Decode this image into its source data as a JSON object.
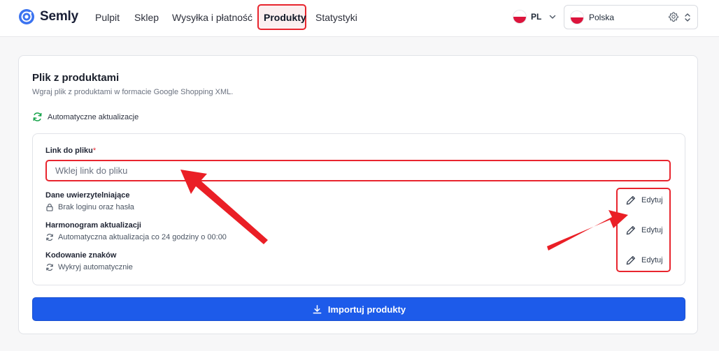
{
  "app": {
    "name": "Semly"
  },
  "nav": {
    "items": [
      {
        "label": "Pulpit"
      },
      {
        "label": "Sklep"
      },
      {
        "label": "Wysyłka i płatność"
      },
      {
        "label": "Produkty"
      },
      {
        "label": "Statystyki"
      }
    ],
    "active": "Produkty"
  },
  "header": {
    "language": "PL",
    "country": "Polska"
  },
  "product_file": {
    "title": "Plik z produktami",
    "subtitle": "Wgraj plik z produktami w formacie Google Shopping XML.",
    "auto_updates_label": "Automatyczne aktualizacje",
    "link_label": "Link do pliku",
    "required_mark": "*",
    "link_placeholder": "Wklej link do pliku",
    "link_value": "",
    "settings": [
      {
        "title": "Dane uwierzytelniające",
        "value": "Brak loginu oraz hasła",
        "icon": "lock-icon",
        "action": "Edytuj"
      },
      {
        "title": "Harmonogram aktualizacji",
        "value": "Automatyczna aktualizacja co 24 godziny o 00:00",
        "icon": "refresh-icon",
        "action": "Edytuj"
      },
      {
        "title": "Kodowanie znaków",
        "value": "Wykryj automatycznie",
        "icon": "refresh-icon",
        "action": "Edytuj"
      }
    ],
    "import_button": "Importuj produkty"
  },
  "colors": {
    "primary": "#1d5bea",
    "highlight": "#e8252e",
    "auto_update_icon": "#16a34a"
  }
}
